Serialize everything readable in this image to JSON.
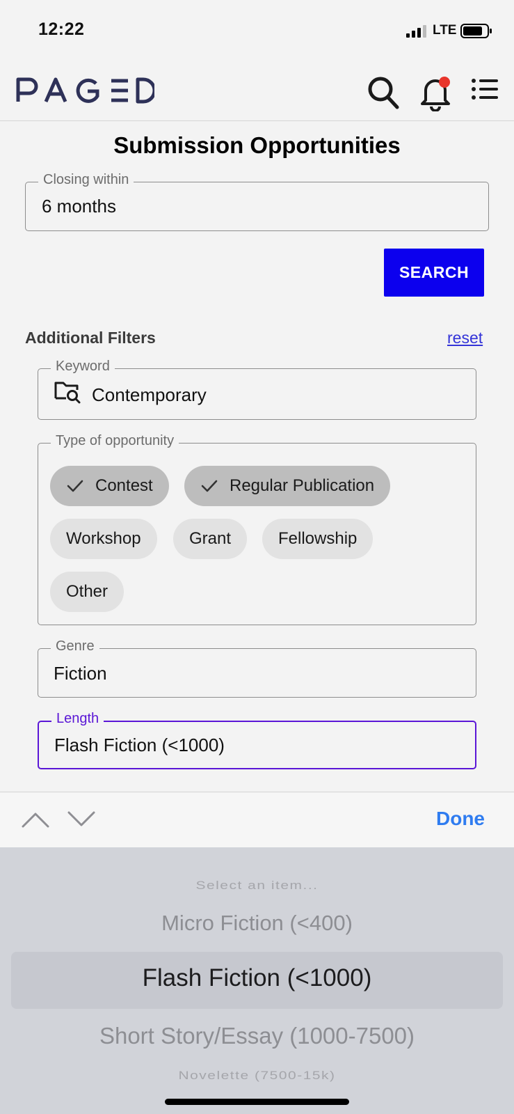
{
  "status_bar": {
    "time": "12:22",
    "network": "LTE",
    "signal_icon": "signal-bars-icon",
    "battery_icon": "battery-icon"
  },
  "header": {
    "logo_text": "PAGED",
    "search_icon": "search-icon",
    "notifications_icon": "bell-icon",
    "has_unread_notification": true,
    "menu_icon": "list-menu-icon",
    "brand_color": "#2e3158",
    "badge_color": "#e8352b"
  },
  "page": {
    "title": "Submission Opportunities"
  },
  "closing_within": {
    "label": "Closing within",
    "value": "6 months"
  },
  "search_button": {
    "label": "SEARCH",
    "color": "#0c00ee"
  },
  "filters": {
    "heading": "Additional Filters",
    "reset_label": "reset",
    "keyword": {
      "label": "Keyword",
      "value": "Contemporary",
      "icon": "folder-search-icon"
    },
    "type_of_opportunity": {
      "label": "Type of opportunity",
      "chips": [
        {
          "label": "Contest",
          "selected": true
        },
        {
          "label": "Regular Publication",
          "selected": true
        },
        {
          "label": "Workshop",
          "selected": false
        },
        {
          "label": "Grant",
          "selected": false
        },
        {
          "label": "Fellowship",
          "selected": false
        },
        {
          "label": "Other",
          "selected": false
        }
      ]
    },
    "genre": {
      "label": "Genre",
      "value": "Fiction"
    },
    "length": {
      "label": "Length",
      "value": "Flash Fiction (<1000)",
      "focus_color": "#5a16d6"
    }
  },
  "keyboard_accessory": {
    "previous_icon": "chevron-up-icon",
    "next_icon": "chevron-down-icon",
    "done_label": "Done"
  },
  "picker": {
    "options": [
      "Select an item...",
      "Micro Fiction (<400)",
      "Flash Fiction (<1000)",
      "Short Story/Essay (1000-7500)",
      "Novelette (7500-15k)"
    ],
    "selected_option": "Flash Fiction (<1000)"
  }
}
